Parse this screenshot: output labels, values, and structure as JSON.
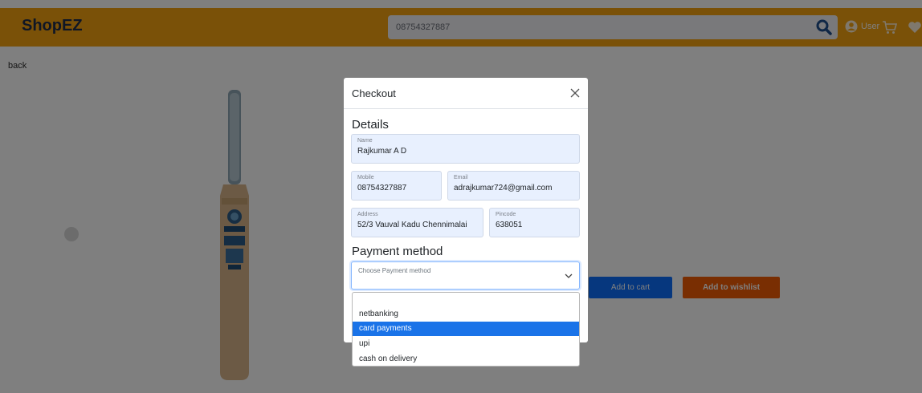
{
  "navbar": {
    "brand": "ShopEZ",
    "search_value": "08754327887",
    "user_label": "User"
  },
  "page": {
    "back_label": "back",
    "add_to_cart_label": "Add to cart",
    "add_to_wishlist_label": "Add to wishlist"
  },
  "modal": {
    "title": "Checkout",
    "details_heading": "Details",
    "fields": {
      "name": {
        "label": "Name",
        "value": "Rajkumar A D"
      },
      "mobile": {
        "label": "Mobile",
        "value": "08754327887"
      },
      "email": {
        "label": "Email",
        "value": "adrajkumar724@gmail.com"
      },
      "address": {
        "label": "Address",
        "value": "52/3 Vauval Kadu Chennimalai"
      },
      "pincode": {
        "label": "Pincode",
        "value": "638051"
      }
    },
    "payment_heading": "Payment method",
    "payment_placeholder": "Choose Payment method"
  },
  "dropdown": {
    "options": [
      "netbanking",
      "card payments",
      "upi",
      "cash on delivery"
    ],
    "highlighted": "card payments"
  },
  "colors": {
    "navbar": "#f5a311",
    "primary": "#0d6efd",
    "wishlist": "#f25c05",
    "highlight": "#1a73e8"
  }
}
